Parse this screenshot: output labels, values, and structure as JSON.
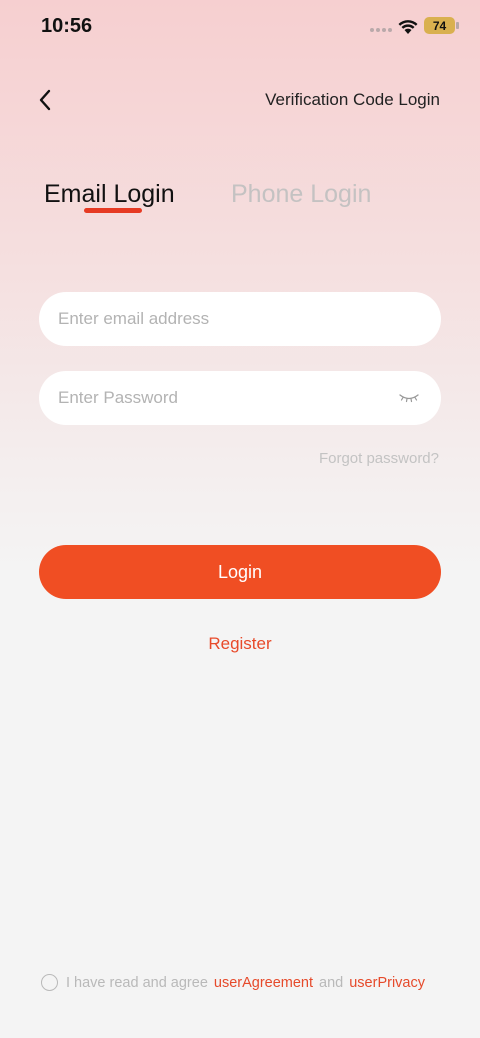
{
  "status_bar": {
    "time": "10:56",
    "battery": "74"
  },
  "header": {
    "back_icon": "chevron-left-icon",
    "verification_link": "Verification Code Login"
  },
  "tabs": [
    {
      "label": "Email Login",
      "active": true
    },
    {
      "label": "Phone Login",
      "active": false
    }
  ],
  "form": {
    "email_placeholder": "Enter email address",
    "email_value": "",
    "password_placeholder": "Enter Password",
    "password_value": "",
    "password_toggle_icon": "eye-closed-icon",
    "forgot_label": "Forgot password?",
    "login_label": "Login",
    "register_label": "Register"
  },
  "agreement": {
    "prefix": "I have read and agree",
    "user_agreement": "userAgreement",
    "conjunction": "and",
    "user_privacy": "userPrivacy",
    "checked": false
  },
  "colors": {
    "accent": "#f04e23",
    "tab_underline": "#e63a23",
    "link": "#e64a2b"
  }
}
